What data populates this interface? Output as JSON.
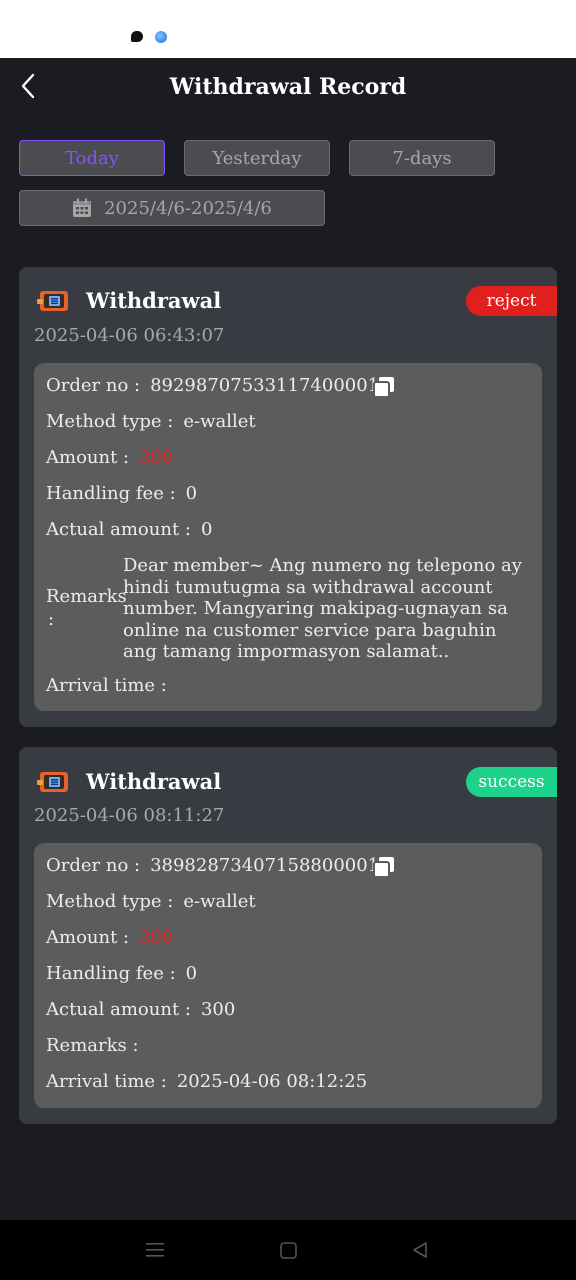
{
  "header": {
    "title": "Withdrawal Record"
  },
  "filters": {
    "today": "Today",
    "yesterday": "Yesterday",
    "seven_days": "7-days",
    "date_range": "2025/4/6-2025/4/6"
  },
  "labels": {
    "order_no": "Order no :",
    "method_type": "Method type :",
    "amount": "Amount :",
    "handling_fee": "Handling fee :",
    "actual_amount": "Actual amount :",
    "remarks": "Remarks",
    "remarks_colon": ":",
    "remarks_inline": "Remarks :",
    "arrival_time": "Arrival time :"
  },
  "records": [
    {
      "title": "Withdrawal",
      "time": "2025-04-06 06:43:07",
      "status": "reject",
      "order_no": "892987075331174000​01",
      "method_type": "e-wallet",
      "amount": "300",
      "handling_fee": "0",
      "actual_amount": "0",
      "remarks": "Dear member~ Ang numero ng telepono ay hindi tumutugma sa withdrawal account number. Mangyaring makipag-ugnayan sa online na customer service para baguhin ang tamang impormasyon salamat..",
      "arrival_time": ""
    },
    {
      "title": "Withdrawal",
      "time": "2025-04-06 08:11:27",
      "status": "success",
      "order_no": "389828734071588000​01",
      "method_type": "e-wallet",
      "amount": "300",
      "handling_fee": "0",
      "actual_amount": "300",
      "remarks": "",
      "arrival_time": "2025-04-06 08:12:25"
    }
  ],
  "colors": {
    "accent": "#8a4fff",
    "reject": "#e0201f",
    "success": "#1fd28b",
    "amount": "#e02525"
  },
  "icons": {
    "back": "chevron-left-icon",
    "calendar": "calendar-icon",
    "copy": "copy-icon",
    "wallet": "wallet-icon"
  }
}
